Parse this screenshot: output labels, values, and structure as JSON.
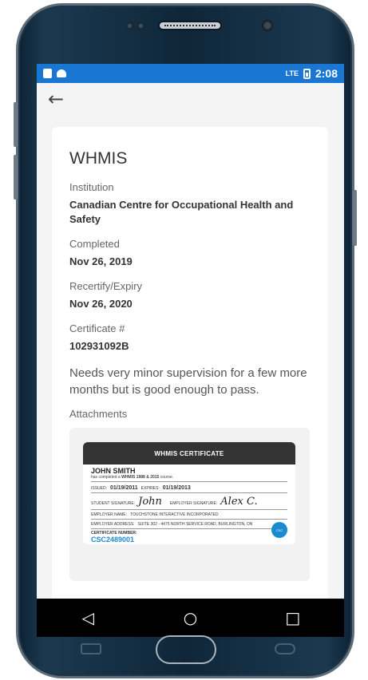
{
  "status_bar": {
    "time": "2:08",
    "network": "LTE"
  },
  "app_bar": {
    "back_icon": "arrow-left-icon"
  },
  "detail": {
    "title": "WHMIS",
    "institution_label": "Institution",
    "institution_value": "Canadian Centre for Occupational Health and Safety",
    "completed_label": "Completed",
    "completed_value": "Nov 26, 2019",
    "expiry_label": "Recertify/Expiry",
    "expiry_value": "Nov 26, 2020",
    "certificate_label": "Certificate #",
    "certificate_value": "102931092B",
    "note": "Needs very minor supervision for a few more months but is good enough to pass.",
    "attachments_label": "Attachments"
  },
  "certificate_image": {
    "header": "WHMIS CERTIFICATE",
    "name": "JOHN SMITH",
    "course_prefix": "has completed a",
    "course_name": "WHMIS 1988 & 2015",
    "course_suffix": "course.",
    "issued_label": "ISSUED:",
    "issued_value": "01/19/2011",
    "expires_label": "EXPIRES:",
    "expires_value": "01/19/2013",
    "student_sig_label": "STUDENT SIGNATURE:",
    "student_sig": "John",
    "employer_sig_label": "EMPLOYER SIGNATURE:",
    "employer_sig": "Alex C.",
    "employer_name_label": "EMPLOYER NAME:",
    "employer_name": "TOUCHSTONE INTERACTIVE INCORPORATED",
    "employer_address_label": "EMPLOYER ADDRESS:",
    "employer_address": "SUITE 302 - 4475 NORTH SERVICE ROAD, BURLINGTON, ON",
    "cert_number_label": "CERTIFICATE NUMBER:",
    "cert_number": "CSC2489001",
    "seal_text": "CSC"
  },
  "nav_bar": {
    "back": "◁",
    "home": "○",
    "recents": "□"
  },
  "colors": {
    "status_bar": "#1976d2",
    "certificate_accent": "#1c8ad0"
  }
}
